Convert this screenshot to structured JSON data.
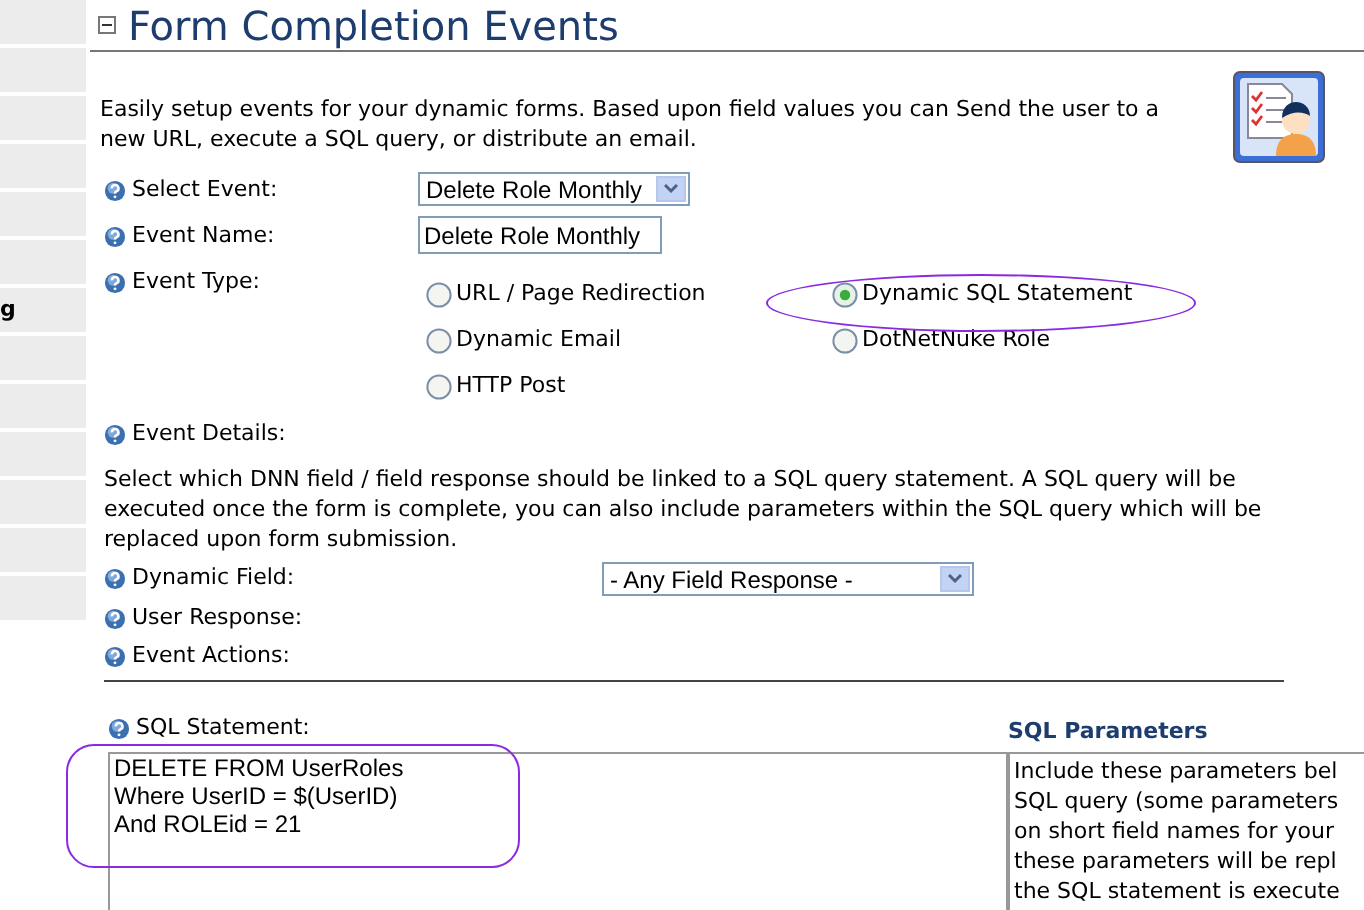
{
  "sidebar": {
    "items": [
      {
        "label": "g"
      }
    ]
  },
  "title": "Form Completion Events",
  "intro": "Easily setup events for your dynamic forms. Based upon field values you can Send the user to a new URL, execute a SQL query, or distribute an email.",
  "select_event": {
    "label": "Select Event:",
    "value": "Delete Role Monthly"
  },
  "event_name": {
    "label": "Event Name:",
    "value": "Delete Role Monthly"
  },
  "event_type": {
    "label": "Event Type:",
    "options": [
      {
        "label": "URL / Page Redirection",
        "selected": false
      },
      {
        "label": "Dynamic SQL Statement",
        "selected": true
      },
      {
        "label": "Dynamic Email",
        "selected": false
      },
      {
        "label": "DotNetNuke Role",
        "selected": false
      },
      {
        "label": "HTTP Post",
        "selected": false
      }
    ]
  },
  "event_details": {
    "label": "Event Details:",
    "description": "Select which DNN field / field response should be linked to a SQL query statement. A SQL query will be executed once the form is complete, you can also include parameters within the SQL query which will be replaced upon form submission."
  },
  "dynamic_field": {
    "label": "Dynamic Field:",
    "value": "- Any Field Response -"
  },
  "user_response": {
    "label": "User Response:"
  },
  "event_actions": {
    "label": "Event Actions:"
  },
  "sql_statement": {
    "label": "SQL Statement:",
    "value": "DELETE FROM UserRoles\nWhere UserID = $(UserID)\nAnd ROLEid = 21"
  },
  "sql_parameters": {
    "title": "SQL Parameters",
    "lines": [
      "Include these parameters bel",
      "SQL query (some parameters",
      "on short field names for your",
      "these parameters will be repl",
      "the SQL statement is execute"
    ]
  }
}
